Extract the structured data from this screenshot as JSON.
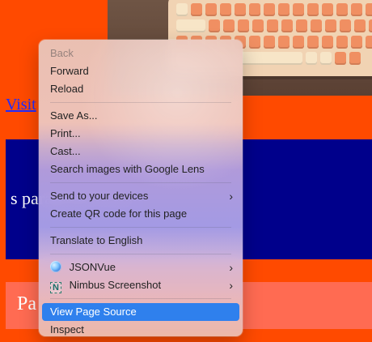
{
  "page": {
    "link_text": "Visit",
    "blue_paragraph": "s paragraph from",
    "bottom_paragraph": "Pa"
  },
  "context_menu": {
    "items": [
      {
        "label": "Back",
        "disabled": true
      },
      {
        "label": "Forward"
      },
      {
        "label": "Reload"
      },
      {
        "label": "Save As..."
      },
      {
        "label": "Print..."
      },
      {
        "label": "Cast..."
      },
      {
        "label": "Search images with Google Lens"
      },
      {
        "label": "Send to your devices",
        "has_submenu": true
      },
      {
        "label": "Create QR code for this page"
      },
      {
        "label": "Translate to English"
      },
      {
        "label": "JSONVue",
        "icon": "jsonvue-icon",
        "has_submenu": true
      },
      {
        "label": "Nimbus Screenshot",
        "icon": "nimbus-screenshot-icon",
        "has_submenu": true
      },
      {
        "label": "View Page Source",
        "selected": true
      },
      {
        "label": "Inspect"
      }
    ]
  },
  "icons": {
    "submenu": "›",
    "nimbus": "N"
  },
  "colors": {
    "page_background": "#ff4a00",
    "blue_block": "#00008b",
    "bottom_block": "#ff6b52",
    "link": "#1e2cff",
    "selection": "#2f80ed"
  }
}
